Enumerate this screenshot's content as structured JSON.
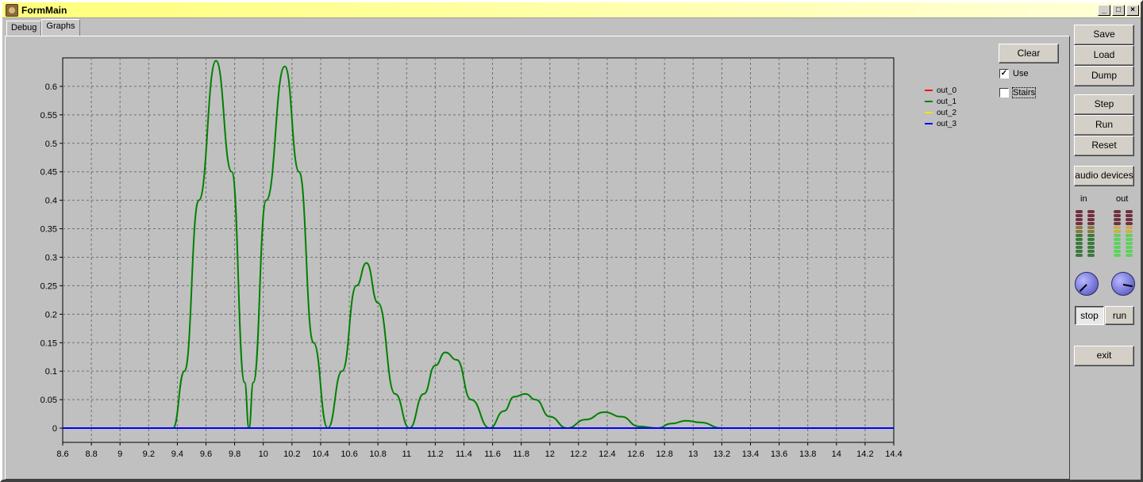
{
  "window": {
    "title": "FormMain",
    "controls": {
      "minimize": "_",
      "maximize": "□",
      "close": "×"
    }
  },
  "tabs": [
    {
      "label": "Debug"
    },
    {
      "label": "Graphs"
    }
  ],
  "graph_controls": {
    "clear_label": "Clear",
    "use_label": "Use",
    "use_checked": true,
    "stairs_label": "Stairs",
    "stairs_checked": false,
    "check_mark": "✓"
  },
  "legend": [
    {
      "name": "out_0",
      "color": "#ff0000"
    },
    {
      "name": "out_1",
      "color": "#008000"
    },
    {
      "name": "out_2",
      "color": "#e8e800"
    },
    {
      "name": "out_3",
      "color": "#0000ff"
    }
  ],
  "sidebar": {
    "save_label": "Save",
    "load_label": "Load",
    "dump_label": "Dump",
    "step_label": "Step",
    "run_label": "Run",
    "reset_label": "Reset",
    "audio_devices_label": "audio devices",
    "meter_in_label": "in",
    "meter_out_label": "out",
    "stop_label": "stop",
    "run_toggle_label": "run",
    "exit_label": "exit"
  },
  "chart_data": {
    "type": "line",
    "xlim": [
      8.6,
      14.4
    ],
    "ylim": [
      -0.025,
      0.65
    ],
    "x_ticks": [
      "8.6",
      "8.8",
      "9",
      "9.2",
      "9.4",
      "9.6",
      "9.8",
      "10",
      "10.2",
      "10.4",
      "10.6",
      "10.8",
      "11",
      "11.2",
      "11.4",
      "11.6",
      "11.8",
      "12",
      "12.2",
      "12.4",
      "12.6",
      "12.8",
      "13",
      "13.2",
      "13.4",
      "13.6",
      "13.8",
      "14",
      "14.2",
      "14.4"
    ],
    "y_ticks": [
      "0",
      "0.05",
      "0.1",
      "0.15",
      "0.2",
      "0.25",
      "0.3",
      "0.35",
      "0.4",
      "0.45",
      "0.5",
      "0.55",
      "0.6"
    ],
    "grid": true,
    "series": [
      {
        "name": "out_1",
        "color": "#008000",
        "x": [
          8.6,
          9.37,
          9.45,
          9.55,
          9.67,
          9.78,
          9.87,
          9.9,
          9.93,
          10.02,
          10.15,
          10.25,
          10.35,
          10.45,
          10.55,
          10.65,
          10.72,
          10.8,
          10.92,
          11.02,
          11.12,
          11.2,
          11.27,
          11.35,
          11.45,
          11.58,
          11.68,
          11.75,
          11.83,
          11.9,
          12.0,
          12.12,
          12.25,
          12.38,
          12.5,
          12.62,
          12.75,
          12.85,
          12.95,
          13.05,
          13.2
        ],
        "y": [
          0,
          0,
          0.1,
          0.4,
          0.645,
          0.45,
          0.08,
          0,
          0.08,
          0.4,
          0.635,
          0.45,
          0.15,
          0,
          0.1,
          0.25,
          0.29,
          0.22,
          0.06,
          0,
          0.06,
          0.11,
          0.133,
          0.12,
          0.05,
          0,
          0.03,
          0.055,
          0.06,
          0.05,
          0.02,
          0,
          0.015,
          0.028,
          0.02,
          0.003,
          0,
          0.008,
          0.013,
          0.01,
          0
        ]
      },
      {
        "name": "out_3",
        "color": "#0000ff",
        "x": [
          8.6,
          14.4
        ],
        "y": [
          0,
          0
        ]
      }
    ]
  }
}
